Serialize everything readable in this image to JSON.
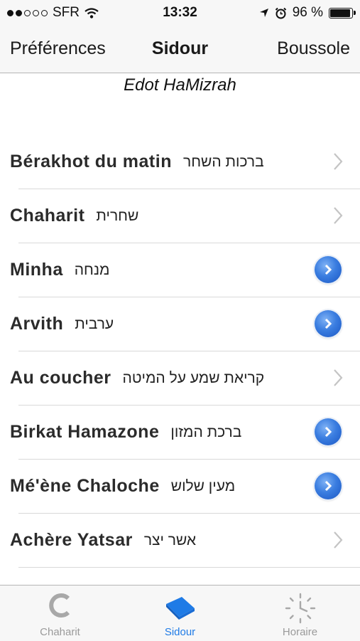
{
  "status": {
    "carrier": "SFR",
    "time": "13:32",
    "battery": "96 %"
  },
  "navbar": {
    "left_button": "Préférences",
    "title": "Sidour",
    "right_button": "Boussole"
  },
  "subtitle": "Edot HaMizrah",
  "items": [
    {
      "fr": "Bérakhot du matin",
      "he": "ברכות השחר",
      "accessory": "chevron"
    },
    {
      "fr": "Chaharit",
      "he": "שחרית",
      "accessory": "chevron"
    },
    {
      "fr": "Minha",
      "he": "מנחה",
      "accessory": "info"
    },
    {
      "fr": "Arvith",
      "he": "ערבית",
      "accessory": "info"
    },
    {
      "fr": "Au coucher",
      "he": "קריאת שמע על המיטה",
      "accessory": "chevron"
    },
    {
      "fr": "Birkat Hamazone",
      "he": "ברכת המזון",
      "accessory": "info"
    },
    {
      "fr": "Mé'ène Chaloche",
      "he": "מעין שלוש",
      "accessory": "info"
    },
    {
      "fr": "Achère Yatsar",
      "he": "אשר יצר",
      "accessory": "chevron"
    }
  ],
  "tabs": [
    {
      "label": "Chaharit",
      "icon": "c-letter-icon",
      "active": false
    },
    {
      "label": "Sidour",
      "icon": "book-icon",
      "active": true
    },
    {
      "label": "Horaire",
      "icon": "clock-icon",
      "active": false
    }
  ],
  "colors": {
    "accent": "#1f7be6",
    "info_button": "#3a7de0"
  }
}
